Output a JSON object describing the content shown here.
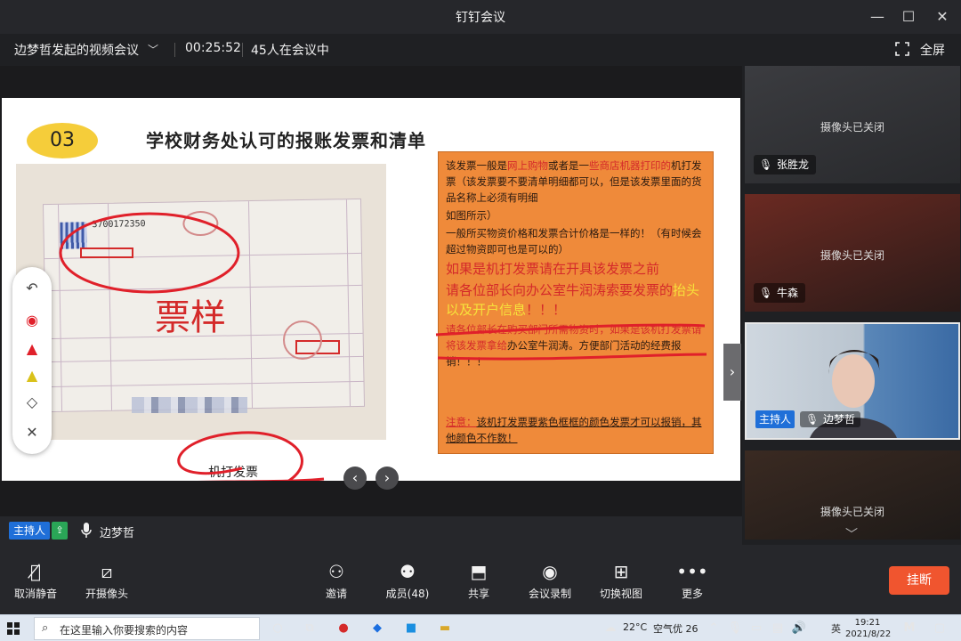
{
  "window": {
    "title": "钉钉会议",
    "minimize": "—",
    "maximize": "☐",
    "close": "✕"
  },
  "meeting": {
    "topic": "边梦哲发起的视频会议",
    "duration": "00:25:52",
    "participants_text": "45人在会议中",
    "fullscreen_label": "全屏"
  },
  "slide": {
    "number": "03",
    "title": "学校财务处认可的报账发票和清单",
    "invoice_code": "3700172350",
    "invoice_watermark": "票样",
    "handwritten_label": "机打发票",
    "note": {
      "p1_a": "该发票一般是",
      "p1_b": "网上购物",
      "p1_c": "或者是一",
      "p1_d": "些商店机器打印的",
      "p1_e": "机打发票（该发票要不要清单明细都可以，但是该发票里面的货品名称上必须有明细",
      "p2": "如图所示）",
      "p3": "一般所买物资价格和发票合计价格是一样的！（有时候会超过物资即可也是可以的）",
      "big1": "如果是机打发票请在开具该发票之前",
      "big2_a": "请各位部长向办公室牛润涛索要",
      "big2_b": "发票的",
      "big2_c": "抬头以及开户信息",
      "big2_d": "！！！",
      "p4_a": "请各位部长在购买部门所需物资时，如果是该机打发票请将该发票拿给",
      "p4_b": "办公室牛润涛。方便部门活动的经费报销！！！",
      "notice_a": "注意：",
      "notice_b": "该机打发票要紫色框框的颜色发票才可以报销，其他颜色不作数！"
    }
  },
  "presenter": {
    "role": "主持人",
    "name": "边梦哲"
  },
  "participants": [
    {
      "name": "张胜龙",
      "status": "摄像头已关闭",
      "muted": true
    },
    {
      "name": "牛森",
      "status": "摄像头已关闭",
      "muted": true
    },
    {
      "name": "边梦哲",
      "role": "主持人",
      "status": "",
      "muted": false
    },
    {
      "name": "",
      "status": "摄像头已关闭",
      "muted": false
    }
  ],
  "controls": {
    "mute": "取消静音",
    "camera": "开摄像头",
    "invite": "邀请",
    "members": "成员(48)",
    "share": "共享",
    "record": "会议录制",
    "switch_view": "切换视图",
    "more": "更多",
    "hangup": "挂断"
  },
  "taskbar": {
    "search_placeholder": "在这里输入你要搜索的内容",
    "temperature": "22°C",
    "air_quality": "空气优 26",
    "ime": "英",
    "time": "19:21",
    "date": "2021/8/22"
  },
  "colors": {
    "accent_blue": "#1f6fd8",
    "hangup_red": "#f0552f",
    "note_orange": "#ef8a3a",
    "slide_number_yellow": "#f5cd3a"
  }
}
